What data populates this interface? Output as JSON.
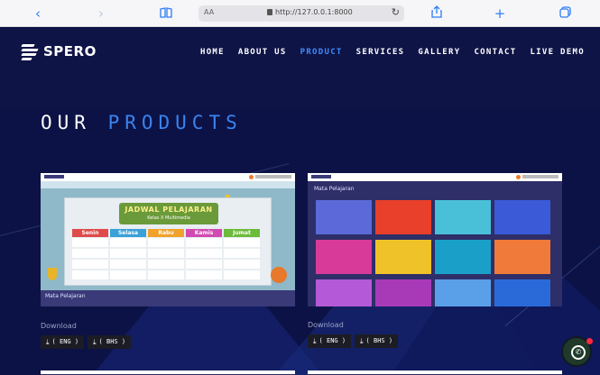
{
  "browser": {
    "url": "http://127.0.0.1:8000",
    "aa_label": "AA",
    "icons": [
      "chevron-left-icon",
      "chevron-right-icon",
      "book-icon",
      "lock-icon",
      "reload-icon",
      "share-icon",
      "plus-icon",
      "tabs-icon"
    ]
  },
  "site": {
    "logo": "SPERO",
    "nav": [
      "HOME",
      "ABOUT US",
      "PRODUCT",
      "SERVICES",
      "GALLERY",
      "CONTACT",
      "LIVE DEMO"
    ],
    "active_nav": "PRODUCT"
  },
  "section": {
    "title_white": "OUR",
    "title_blue": "PRODUCTS"
  },
  "cards": [
    {
      "banner_title": "JADWAL PELAJARAN",
      "banner_subtitle": "Kelas X Multimedia",
      "days": [
        "Senin",
        "Selasa",
        "Rabu",
        "Kamis",
        "Jumat"
      ],
      "footer_label": "Mata Pelajaran",
      "download_label": "Download",
      "buttons": [
        "( ENG )",
        "( BHS )"
      ]
    },
    {
      "label": "Mata Pelajaran",
      "download_label": "Download",
      "buttons": [
        "( ENG )",
        "( BHS )"
      ]
    }
  ],
  "colors": {
    "accent": "#3a83f0",
    "page_bg": "#0a0f3d",
    "day_colors": [
      "#e04a4a",
      "#3aa0d8",
      "#f0a22a",
      "#d04ab0",
      "#6cbb3a"
    ]
  },
  "whatsapp": {
    "icon": "whatsapp-icon",
    "badge": true
  }
}
